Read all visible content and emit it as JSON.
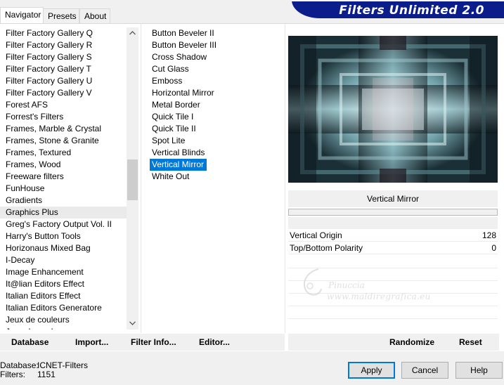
{
  "tabs": [
    "Navigator",
    "Presets",
    "About"
  ],
  "banner_title": "Filters Unlimited 2.0",
  "categories": [
    "Filter Factory Gallery Q",
    "Filter Factory Gallery R",
    "Filter Factory Gallery S",
    "Filter Factory Gallery T",
    "Filter Factory Gallery U",
    "Filter Factory Gallery V",
    "Forest AFS",
    "Forrest's Filters",
    "Frames, Marble & Crystal",
    "Frames, Stone & Granite",
    "Frames, Textured",
    "Frames, Wood",
    "Freeware filters",
    "FunHouse",
    "Gradients",
    "Graphics Plus",
    "Greg's Factory Output Vol. II",
    "Harry's Button Tools",
    "Horizonaus Mixed Bag",
    "I-Decay",
    "Image Enhancement",
    "It@lian Editors Effect",
    "Italian Editors Effect",
    "Italian Editors Generatore",
    "Jeux de couleurs",
    "Jeux de couleurs"
  ],
  "selected_category": "Graphics Plus",
  "filters": [
    "Button Beveler II",
    "Button Beveler III",
    "Cross Shadow",
    "Cut Glass",
    "Emboss",
    "Horizontal Mirror",
    "Metal Border",
    "Quick Tile I",
    "Quick Tile II",
    "Spot Lite",
    "Vertical Blinds",
    "Vertical Mirror",
    "White Out"
  ],
  "selected_filter": "Vertical Mirror",
  "param_title": "Vertical Mirror",
  "params": [
    {
      "name": "Vertical Origin",
      "value": "128"
    },
    {
      "name": "Top/Bottom Polarity",
      "value": "0"
    }
  ],
  "watermark": {
    "line1": "Pinuccia",
    "line2": "www.maldiregrafica.eu"
  },
  "links": {
    "database": "Database",
    "import": "Import...",
    "filter_info": "Filter Info...",
    "editor": "Editor...",
    "randomize": "Randomize",
    "reset": "Reset"
  },
  "status": {
    "database_label": "Database:",
    "database_value": "ICNET-Filters",
    "filters_label": "Filters:",
    "filters_value": "1151"
  },
  "buttons": {
    "apply": "Apply",
    "cancel": "Cancel",
    "help": "Help"
  },
  "scroll_icons": {
    "up": "chevron-up-icon",
    "down": "chevron-down-icon"
  },
  "colors": {
    "selection": "#0078d7",
    "banner": "#0b1d8a"
  }
}
